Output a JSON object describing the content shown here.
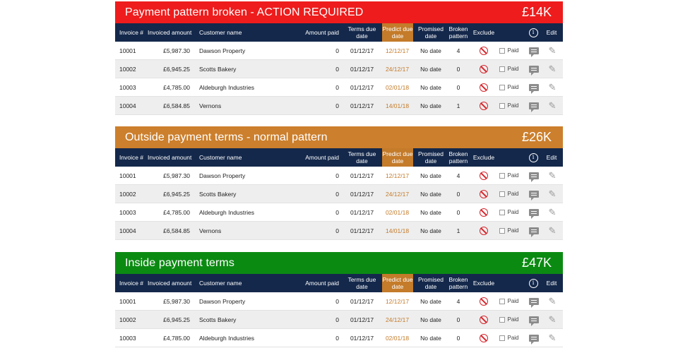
{
  "headers": {
    "invoice": "Invoice #",
    "amount": "Invoiced amount",
    "customer": "Customer name",
    "paid": "Amount paid",
    "terms": "Terms due date",
    "predict": "Predict due date",
    "promised": "Promised date",
    "broken": "Broken pattern",
    "exclude": "Exclude",
    "info": "i",
    "edit": "Edit"
  },
  "colors": {
    "red": "#ee1c1c",
    "orange": "#cc7f2c",
    "green": "#0b8a12",
    "header": "#14284b",
    "predict": "#c47b2a"
  },
  "icons": {
    "exclude": "ban-icon",
    "comment": "comment-icon",
    "edit": "pencil-icon",
    "info": "info-icon"
  },
  "paid_label": "Paid",
  "sections": [
    {
      "title": "Payment pattern broken - ACTION REQUIRED",
      "total": "£14K",
      "rows": [
        {
          "invoice": "10001",
          "amount": "£5,987.30",
          "customer": "Dawson Property",
          "paid": "0",
          "terms": "01/12/17",
          "predict": "12/12/17",
          "promised": "No date",
          "broken": "4"
        },
        {
          "invoice": "10002",
          "amount": "£6,945.25",
          "customer": "Scotts Bakery",
          "paid": "0",
          "terms": "01/12/17",
          "predict": "24/12/17",
          "promised": "No date",
          "broken": "0"
        },
        {
          "invoice": "10003",
          "amount": "£4,785.00",
          "customer": "Aldeburgh Industries",
          "paid": "0",
          "terms": "01/12/17",
          "predict": "02/01/18",
          "promised": "No date",
          "broken": "0"
        },
        {
          "invoice": "10004",
          "amount": "£6,584.85",
          "customer": "Vernons",
          "paid": "0",
          "terms": "01/12/17",
          "predict": "14/01/18",
          "promised": "No date",
          "broken": "1"
        }
      ]
    },
    {
      "title": "Outside payment terms - normal pattern",
      "total": "£26K",
      "rows": [
        {
          "invoice": "10001",
          "amount": "£5,987.30",
          "customer": "Dawson Property",
          "paid": "0",
          "terms": "01/12/17",
          "predict": "12/12/17",
          "promised": "No date",
          "broken": "4"
        },
        {
          "invoice": "10002",
          "amount": "£6,945.25",
          "customer": "Scotts Bakery",
          "paid": "0",
          "terms": "01/12/17",
          "predict": "24/12/17",
          "promised": "No date",
          "broken": "0"
        },
        {
          "invoice": "10003",
          "amount": "£4,785.00",
          "customer": "Aldeburgh Industries",
          "paid": "0",
          "terms": "01/12/17",
          "predict": "02/01/18",
          "promised": "No date",
          "broken": "0"
        },
        {
          "invoice": "10004",
          "amount": "£6,584.85",
          "customer": "Vernons",
          "paid": "0",
          "terms": "01/12/17",
          "predict": "14/01/18",
          "promised": "No date",
          "broken": "1"
        }
      ]
    },
    {
      "title": "Inside payment terms",
      "total": "£47K",
      "rows": [
        {
          "invoice": "10001",
          "amount": "£5,987.30",
          "customer": "Dawson Property",
          "paid": "0",
          "terms": "01/12/17",
          "predict": "12/12/17",
          "promised": "No date",
          "broken": "4"
        },
        {
          "invoice": "10002",
          "amount": "£6,945.25",
          "customer": "Scotts Bakery",
          "paid": "0",
          "terms": "01/12/17",
          "predict": "24/12/17",
          "promised": "No date",
          "broken": "0"
        },
        {
          "invoice": "10003",
          "amount": "£4,785.00",
          "customer": "Aldeburgh Industries",
          "paid": "0",
          "terms": "01/12/17",
          "predict": "02/01/18",
          "promised": "No date",
          "broken": "0"
        }
      ]
    }
  ]
}
